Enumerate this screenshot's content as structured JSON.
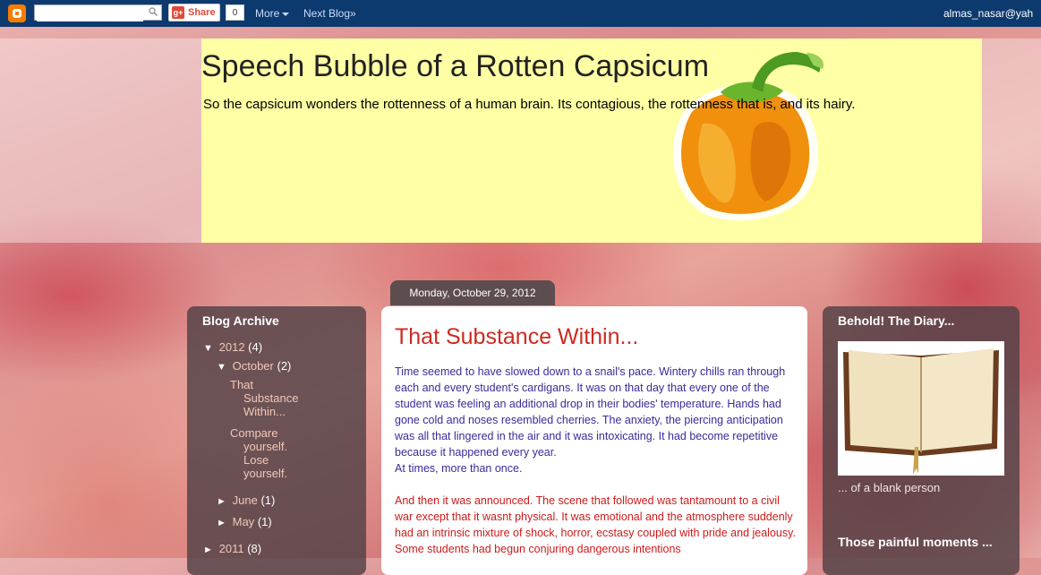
{
  "navbar": {
    "logo_icon": "blogger-logo-icon",
    "search_placeholder": "",
    "share_label": "Share",
    "share_count": "0",
    "more_label": "More",
    "next_blog_label": "Next Blog»",
    "user": "almas_nasar@yah"
  },
  "header": {
    "title": "Speech Bubble of a Rotten Capsicum",
    "description": "So the capsicum wonders the rottenness of a human brain. Its contagious, the rottenness that is, and its hairy."
  },
  "post": {
    "date": "Monday, October 29, 2012",
    "title": "That Substance Within...",
    "paragraph1": "Time seemed to have slowed down to a snail's pace. Wintery chills ran through each and every student's cardigans. It was on that day that every one of the student was feeling an additional drop in their bodies' temperature. Hands had gone cold and noses resembled cherries. The anxiety, the piercing anticipation was all that lingered in the air and it was intoxicating. It had become repetitive because it happened every year.",
    "paragraph1b": "At times, more than once.",
    "paragraph2": "And then it was announced. The scene that followed was tantamount to a civil war except that it wasnt physical. It was emotional and the atmosphere suddenly had an intrinsic mixture of shock, horror, ecstasy coupled with pride and jealousy. Some students had begun conjuring dangerous intentions"
  },
  "archive": {
    "title": "Blog Archive",
    "y2012": {
      "label": "2012",
      "count": "(4)",
      "toggle": "▼"
    },
    "oct": {
      "label": "October",
      "count": "(2)",
      "toggle": "▼"
    },
    "post1": "That Substance Within...",
    "post1_l1": "That",
    "post1_l2": "Substance",
    "post1_l3": "Within...",
    "post2_l1": "Compare",
    "post2_l2": "yourself.",
    "post2_l3": "Lose",
    "post2_l4": "yourself.",
    "june": {
      "label": "June",
      "count": "(1)",
      "toggle": "►"
    },
    "may": {
      "label": "May",
      "count": "(1)",
      "toggle": "►"
    },
    "y2011": {
      "label": "2011",
      "count": "(8)",
      "toggle": "►"
    }
  },
  "right_sidebar": {
    "title": "Behold! The Diary...",
    "image_icon": "open-book-image",
    "caption": "... of a blank person",
    "title2": "Those painful moments ..."
  },
  "colors": {
    "navbar": "#0d3a6e",
    "header_box": "#ffffa5",
    "post_title": "#cc2b22",
    "sidebar": "#504146"
  }
}
